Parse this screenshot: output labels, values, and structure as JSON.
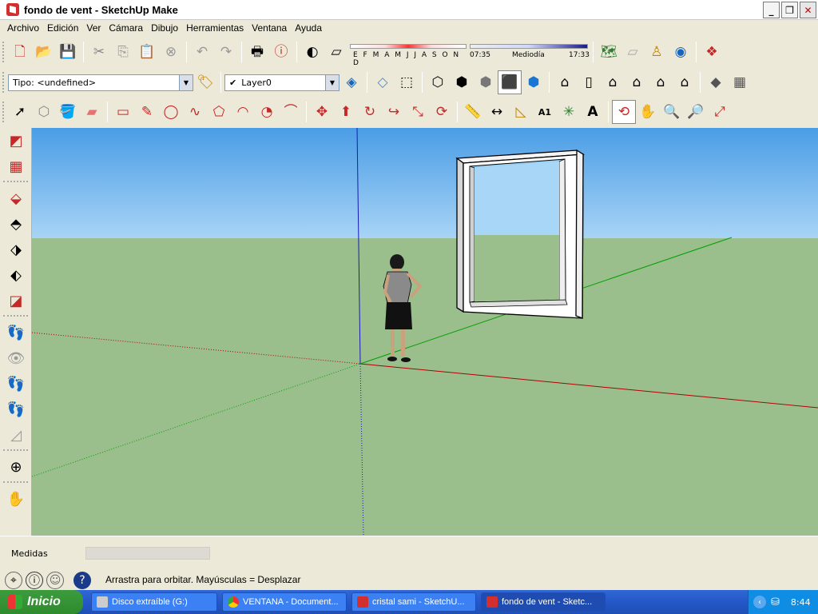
{
  "window": {
    "title": "fondo de vent - SketchUp Make"
  },
  "menu": [
    "Archivo",
    "Edición",
    "Ver",
    "Cámara",
    "Dibujo",
    "Herramientas",
    "Ventana",
    "Ayuda"
  ],
  "toolbar": {
    "style_combo": "Tipo: <undefined>",
    "layer_combo": "Layer0",
    "months_label": "E F M A M J J A S O N D",
    "time_start": "07:35",
    "time_mid": "Mediodía",
    "time_end": "17:33"
  },
  "status": {
    "measure_label": "Medidas",
    "hint": "Arrastra para orbitar. Mayúsculas = Desplazar"
  },
  "taskbar": {
    "start": "Inicio",
    "tasks": [
      "Disco extraíble (G:)",
      "VENTANA - Document...",
      "cristal sami - SketchU...",
      "fondo de vent - Sketc..."
    ],
    "clock": "8:44"
  },
  "colors": {
    "sky": "#7fbdf0",
    "ground": "#9bbf8c",
    "axis_red": "#c00000",
    "axis_green": "#00a000",
    "axis_blue": "#0000c0"
  }
}
